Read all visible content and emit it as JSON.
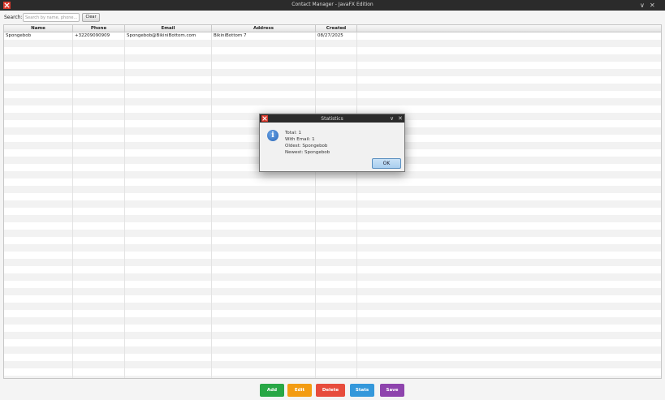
{
  "window": {
    "title": "Contact Manager - JavaFX Edition",
    "min_glyph": "∨",
    "close_glyph": "✕"
  },
  "toolbar": {
    "search_label": "Search:",
    "search_placeholder": "Search by name, phone...",
    "search_value": "",
    "clear_label": "Clear"
  },
  "table": {
    "columns": [
      "Name",
      "Phone",
      "Email",
      "Address",
      "Created"
    ],
    "rows": [
      [
        "Spongebob",
        "+32209090909",
        "Spongebob@BikiniBottom.com",
        "BikiniBottom 7",
        "08/27/2025"
      ]
    ]
  },
  "buttons": {
    "add": "Add",
    "edit": "Edit",
    "delete": "Delete",
    "stats": "Stats",
    "save": "Save",
    "colors": {
      "add": "#28a745",
      "edit": "#f39c12",
      "delete": "#e74c3c",
      "stats": "#3498db",
      "save": "#8e44ad"
    }
  },
  "dialog": {
    "title": "Statistics",
    "icon": "info-icon",
    "lines": [
      "Total: 1",
      "With Email: 1",
      "Oldest: Spongebob",
      "Newest: Spongebob"
    ],
    "ok_label": "OK"
  }
}
